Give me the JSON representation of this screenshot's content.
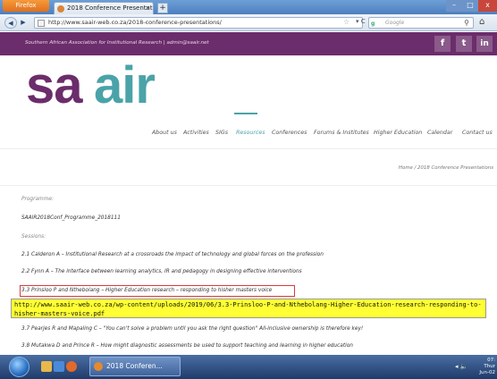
{
  "browser": {
    "app_button": "Firefox",
    "tab_title": "2018 Conference Presentations -...",
    "tab_close": "×",
    "new_tab": "+",
    "url": "http://www.saair-web.co.za/2018-conference-presentations/",
    "search_placeholder": "Google",
    "search_engine_glyph": "g",
    "icons": {
      "back": "◀",
      "forward": "▶",
      "star": "☆",
      "reload": "▾ C",
      "search": "⚲",
      "home": "⌂",
      "minimize": "–",
      "maximize": "□",
      "close": "x"
    }
  },
  "site": {
    "association_line": "Southern African Association for Institutional Research  |  admin@saair.net",
    "social": [
      "f",
      "t",
      "in"
    ],
    "logo_text": "saair",
    "menu": [
      "About us",
      "Activities",
      "SIGs",
      "Resources",
      "Conferences",
      "Forums & Institutes",
      "Higher Education",
      "Calendar",
      "Contact us"
    ],
    "active_menu": "Resources",
    "breadcrumb": "Home / 2018 Conference Presentations"
  },
  "content": {
    "programme_label": "Programme:",
    "programme_file": "SAAIR2018Conf_Programme_2018111",
    "sessions_label": "Sessions:",
    "sessions": [
      "2.1 Calderon A – Institutional Research at a crossroads the impact of technology and global forces on the profession",
      "2.2 Fynn A – The interface between learning analytics, IR and pedagogy in designing effective interventions",
      "3.3 Prinsloo P and Nthebolang – Higher Education research – responding to hisher masters voice",
      "3.7 Pearjes R and Mapaling C – \"You can't solve a problem until you ask the right question\" All-inclusive ownership is therefore key!",
      "3.8 Mutakwa D and Prince R – How might diagnostic assessments be used to support teaching and learning in higher education"
    ]
  },
  "tooltip": {
    "text": "http://www.saair-web.co.za/wp-content/uploads/2019/06/3.3-Prinsloo-P-and-Nthebolang-Higher-Education-research-responding-to-hisher-masters-voice.pdf"
  },
  "taskbar": {
    "window_label": "2018 Conferen...",
    "tray_icons": "◂ 🔈",
    "clock_line1": "07:",
    "clock_line2": "Thur",
    "clock_line3": "Jun-02"
  },
  "colors": {
    "brand_purple": "#6b2d6b",
    "brand_teal": "#4aa3a8",
    "tooltip_yellow": "#ffff33",
    "highlight_red": "#d83a3a"
  }
}
